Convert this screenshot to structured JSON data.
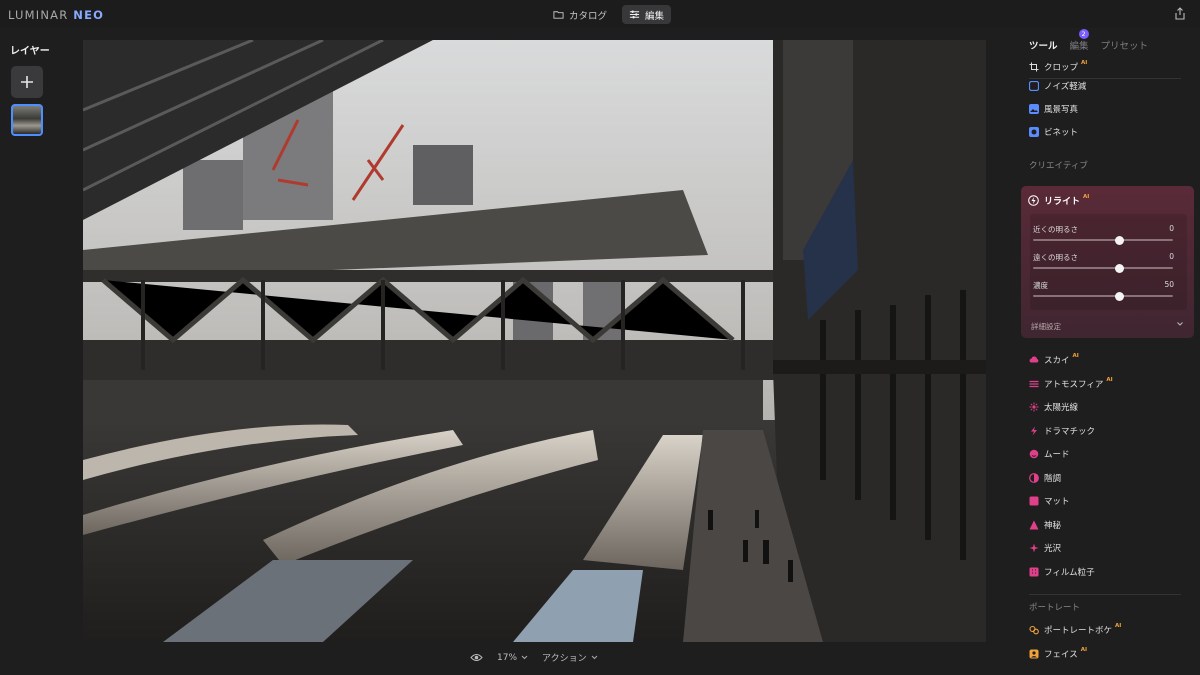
{
  "app": {
    "logo_main": "LUMINAR",
    "logo_accent": "NEO"
  },
  "top_tabs": [
    {
      "label": "カタログ",
      "icon": "folder-icon",
      "active": false
    },
    {
      "label": "編集",
      "icon": "sliders-icon",
      "active": true
    }
  ],
  "layers": {
    "title": "レイヤー"
  },
  "bottom": {
    "zoom": "17%",
    "actions": "アクション"
  },
  "panel": {
    "tabs": [
      {
        "label": "ツール",
        "active": true
      },
      {
        "label": "編集",
        "active": false,
        "badge": "2"
      },
      {
        "label": "プリセット",
        "active": false
      }
    ],
    "tools_top": [
      {
        "label": "クロップ",
        "ai": "AI",
        "icon": "crop-icon"
      },
      {
        "label": "ノイズ軽減",
        "ai": "",
        "icon": "noise-icon"
      },
      {
        "label": "風景写真",
        "ai": "",
        "icon": "landscape-icon"
      },
      {
        "label": "ビネット",
        "ai": "",
        "icon": "vignette-icon"
      }
    ],
    "creative_title": "クリエイティブ",
    "relight": {
      "title": "リライト",
      "ai": "AI",
      "sliders": [
        {
          "label": "近くの明るさ",
          "value": "0",
          "level": 0.5
        },
        {
          "label": "遠くの明るさ",
          "value": "0",
          "level": 0.5
        },
        {
          "label": "濃度",
          "value": "50",
          "level": 0.5
        }
      ],
      "advanced": "詳細設定"
    },
    "creative_tools": [
      {
        "label": "スカイ",
        "ai": "AI",
        "icon": "sky-icon",
        "color": "#e0408a"
      },
      {
        "label": "アトモスフィア",
        "ai": "AI",
        "icon": "atmosphere-icon",
        "color": "#e0408a"
      },
      {
        "label": "太陽光線",
        "ai": "",
        "icon": "sunrays-icon",
        "color": "#e0408a"
      },
      {
        "label": "ドラマチック",
        "ai": "",
        "icon": "dramatic-icon",
        "color": "#e0408a"
      },
      {
        "label": "ムード",
        "ai": "",
        "icon": "mood-icon",
        "color": "#e0408a"
      },
      {
        "label": "階調",
        "ai": "",
        "icon": "toning-icon",
        "color": "#e0408a"
      },
      {
        "label": "マット",
        "ai": "",
        "icon": "matte-icon",
        "color": "#e0408a"
      },
      {
        "label": "神秘",
        "ai": "",
        "icon": "mystical-icon",
        "color": "#e0408a"
      },
      {
        "label": "光沢",
        "ai": "",
        "icon": "glow-icon",
        "color": "#e0408a"
      },
      {
        "label": "フィルム粒子",
        "ai": "",
        "icon": "film-grain-icon",
        "color": "#e0408a"
      }
    ],
    "portrait_title": "ポートレート",
    "portrait_tools": [
      {
        "label": "ポートレートボケ",
        "ai": "AI",
        "icon": "portrait-bokeh-icon",
        "color": "#f3a33b"
      },
      {
        "label": "フェイス",
        "ai": "AI",
        "icon": "face-icon",
        "color": "#f3a33b"
      }
    ]
  }
}
